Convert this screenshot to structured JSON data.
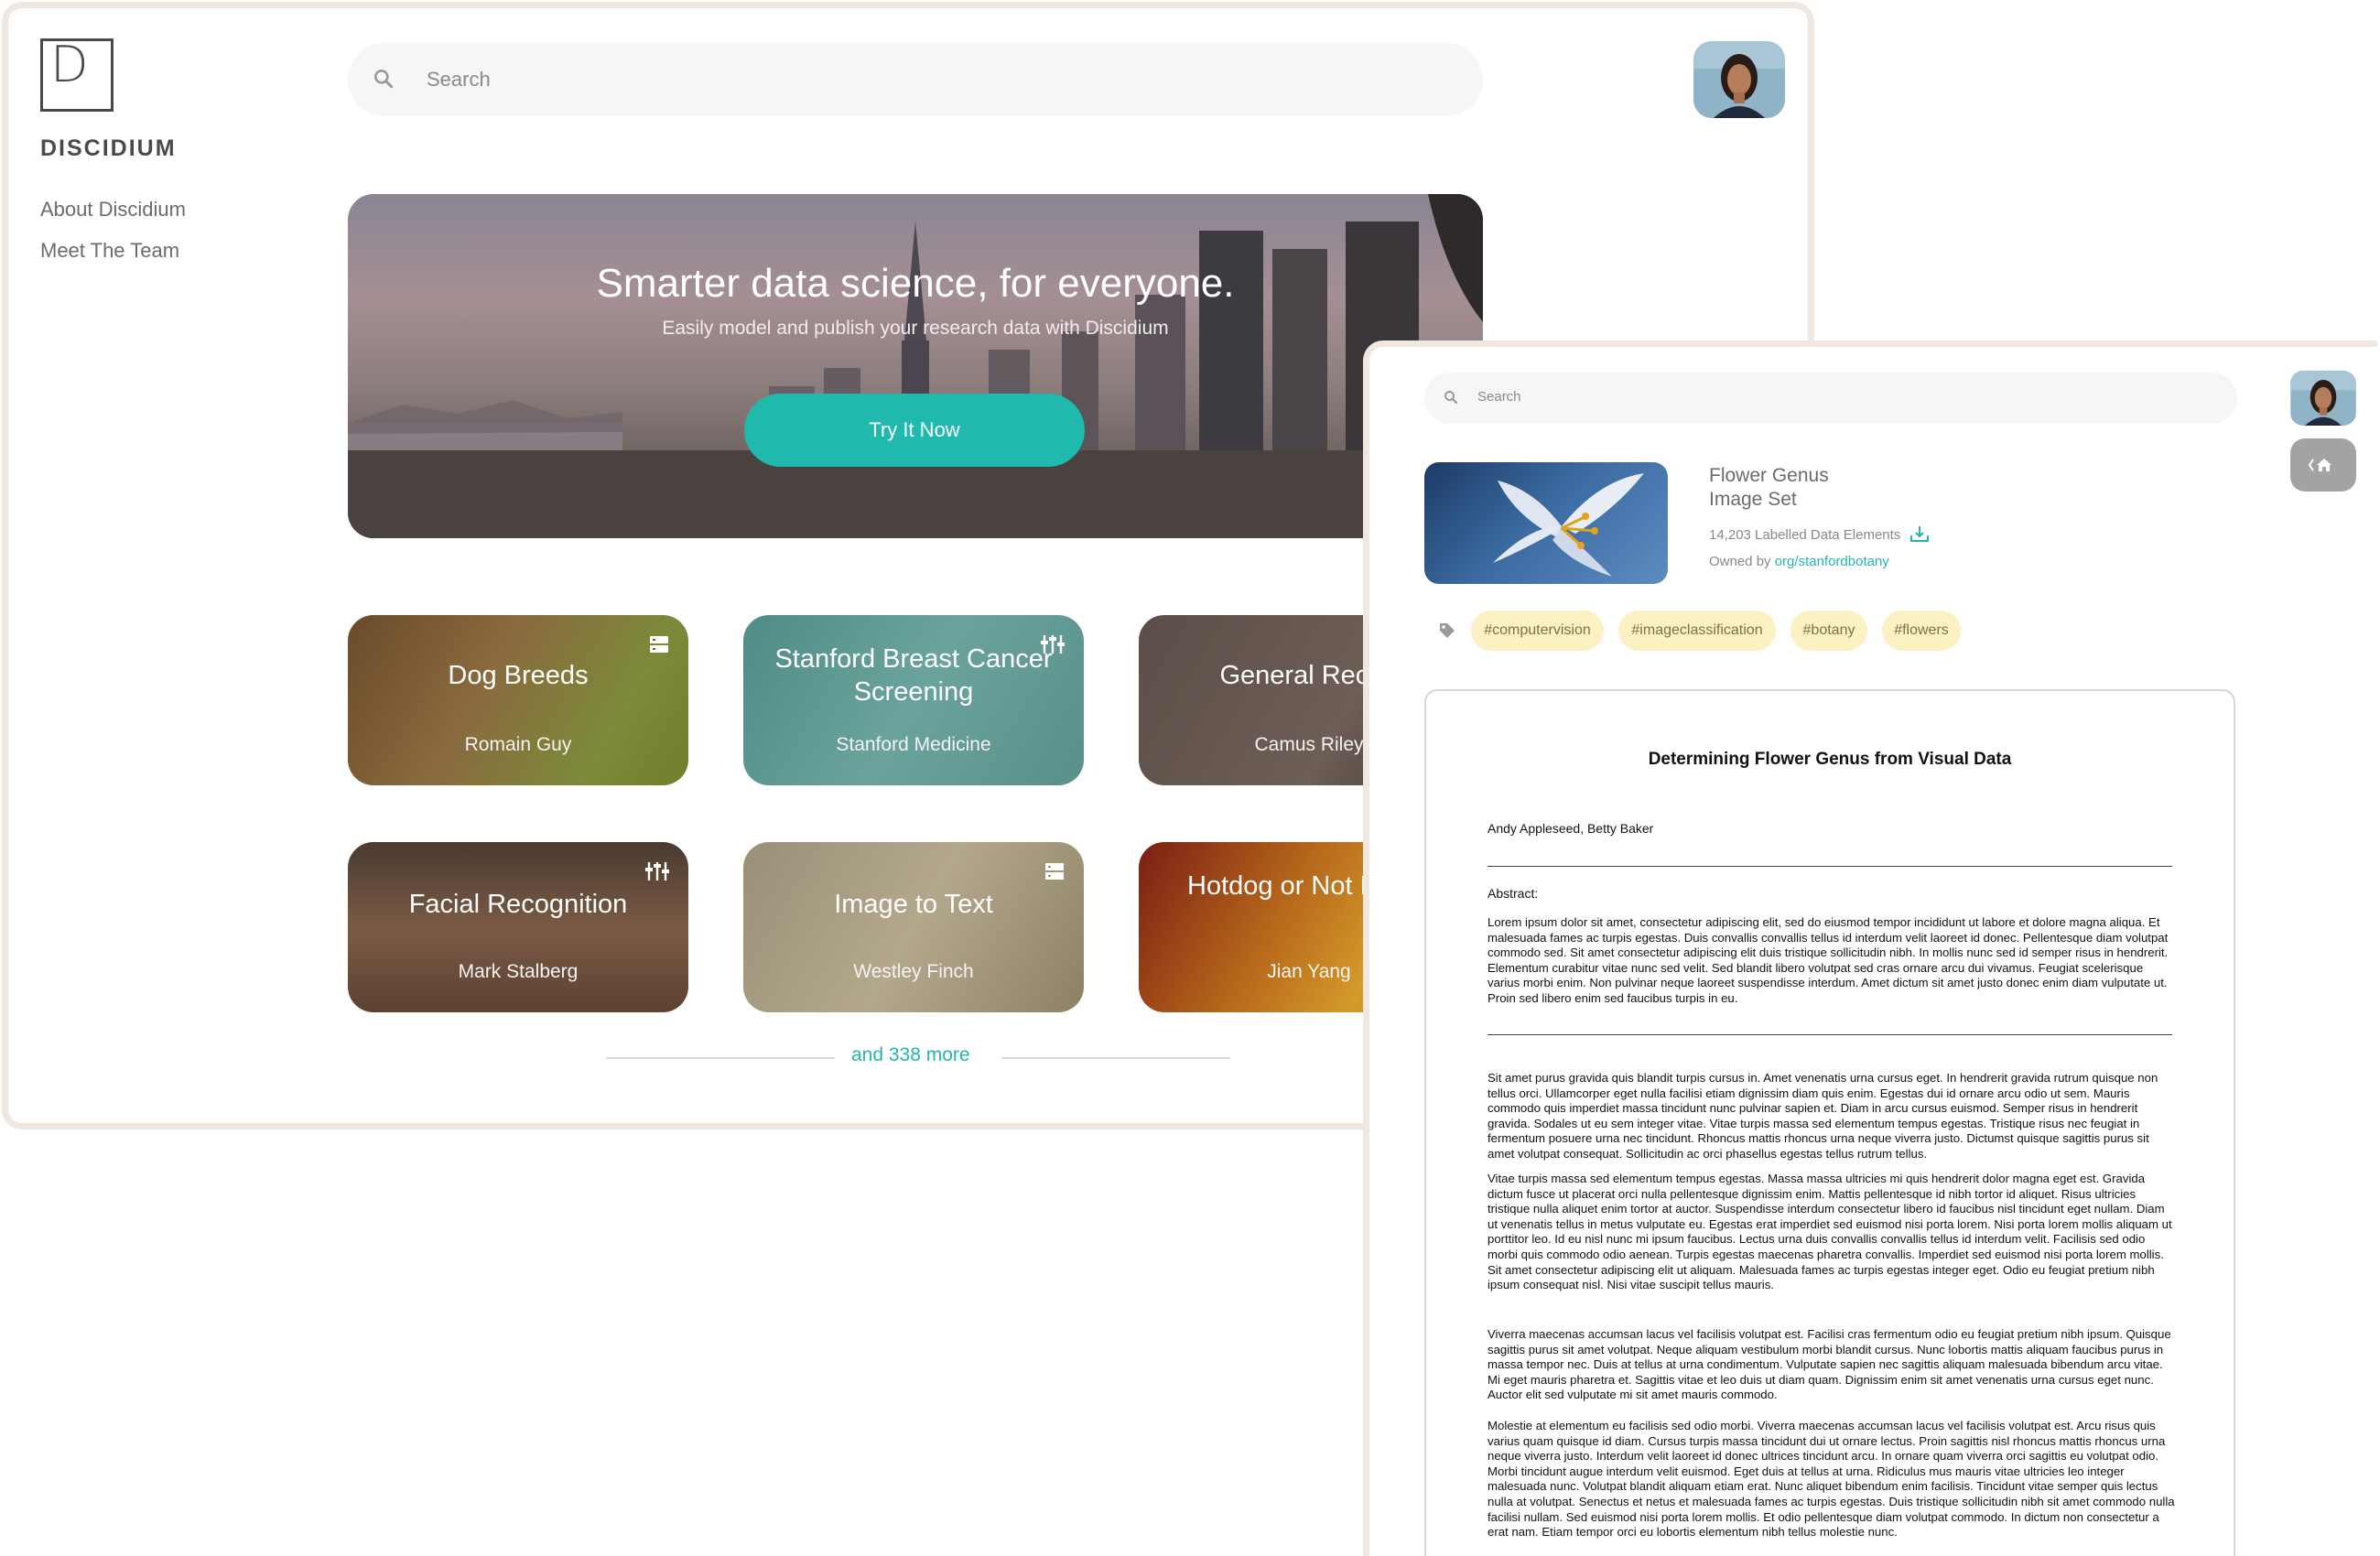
{
  "main_window": {
    "brand": {
      "logo_letter": "D",
      "name": "DISCIDIUM"
    },
    "sidebar": {
      "items": [
        {
          "label": "About Discidium"
        },
        {
          "label": "Meet The Team"
        }
      ]
    },
    "search": {
      "placeholder": "Search"
    },
    "hero": {
      "title": "Smarter data science, for everyone.",
      "subtitle": "Easily model and publish your research data with Discidium",
      "cta_label": "Try It Now"
    },
    "projects": [
      {
        "title": "Dog Breeds",
        "author": "Romain Guy",
        "icon": "server-icon"
      },
      {
        "title": "Stanford Breast Cancer Screening",
        "author": "Stanford Medicine",
        "icon": "equalizer-icon"
      },
      {
        "title": "General Recog",
        "author": "Camus Riley",
        "icon": ""
      },
      {
        "title": "Facial Recognition",
        "author": "Mark Stalberg",
        "icon": "equalizer-icon"
      },
      {
        "title": "Image to Text",
        "author": "Westley Finch",
        "icon": "server-icon"
      },
      {
        "title": "Hotdog or Not Hotdo",
        "author": "Jian Yang",
        "icon": ""
      }
    ],
    "more_label": "and 338 more",
    "colors": {
      "accent": "#1fb9ae",
      "frame": "#efe7e0"
    }
  },
  "detail_window": {
    "search": {
      "placeholder": "Search"
    },
    "dataset": {
      "title_line1": "Flower Genus",
      "title_line2": "Image Set",
      "count": "14,203 Labelled Data Elements",
      "owner_prefix": "Owned by",
      "owner_link": "org/stanfordbotany"
    },
    "tags": [
      "#computervision",
      "#imageclassification",
      "#botany",
      "#flowers"
    ],
    "paper": {
      "title": "Determining Flower Genus from Visual Data",
      "authors": "Andy Appleseed, Betty Baker",
      "abstract_label": "Abstract:",
      "abstract": "Lorem ipsum dolor sit amet, consectetur adipiscing elit, sed do eiusmod tempor incididunt ut labore et dolore magna aliqua. Et malesuada fames ac turpis egestas. Duis convallis convallis tellus id interdum velit laoreet id donec. Pellentesque diam volutpat commodo sed. Sit amet consectetur adipiscing elit duis tristique sollicitudin nibh. In mollis nunc sed id semper risus in hendrerit. Elementum curabitur vitae nunc sed velit. Sed blandit libero volutpat sed cras ornare arcu dui vivamus. Feugiat scelerisque varius morbi enim. Non pulvinar neque laoreet suspendisse interdum. Amet dictum sit amet justo donec enim diam vulputate ut. Proin sed libero enim sed faucibus turpis in eu.",
      "paragraphs": [
        "Sit amet purus gravida quis blandit turpis cursus in. Amet venenatis urna cursus eget. In hendrerit gravida rutrum quisque non tellus orci. Ullamcorper eget nulla facilisi etiam dignissim diam quis enim. Egestas dui id ornare arcu odio ut sem. Mauris commodo quis imperdiet massa tincidunt nunc pulvinar sapien et. Diam in arcu cursus euismod. Semper risus in hendrerit gravida. Sodales ut eu sem integer vitae. Vitae turpis massa sed elementum tempus egestas. Tristique risus nec feugiat in fermentum posuere urna nec tincidunt. Rhoncus mattis rhoncus urna neque viverra justo. Dictumst quisque sagittis purus sit amet volutpat consequat. Sollicitudin ac orci phasellus egestas tellus rutrum tellus.",
        "Vitae turpis massa sed elementum tempus egestas. Massa massa ultricies mi quis hendrerit dolor magna eget est. Gravida dictum fusce ut placerat orci nulla pellentesque dignissim enim. Mattis pellentesque id nibh tortor id aliquet. Risus ultricies tristique nulla aliquet enim tortor at auctor. Suspendisse interdum consectetur libero id faucibus nisl tincidunt eget nullam. Diam ut venenatis tellus in metus vulputate eu. Egestas erat imperdiet sed euismod nisi porta lorem. Nisi porta lorem mollis aliquam ut porttitor leo. Id eu nisl nunc mi ipsum faucibus. Lectus urna duis convallis convallis tellus id interdum velit. Facilisis sed odio morbi quis commodo odio aenean. Turpis egestas maecenas pharetra convallis. Imperdiet sed euismod nisi porta lorem mollis. Sit amet consectetur adipiscing elit ut aliquam. Malesuada fames ac turpis egestas integer eget. Odio eu feugiat pretium nibh ipsum consequat nisl. Nisi vitae suscipit tellus mauris.",
        "Viverra maecenas accumsan lacus vel facilisis volutpat est. Facilisi cras fermentum odio eu feugiat pretium nibh ipsum. Quisque sagittis purus sit amet volutpat. Neque aliquam vestibulum morbi blandit cursus. Nunc lobortis mattis aliquam faucibus purus in massa tempor nec. Duis at tellus at urna condimentum. Vulputate sapien nec sagittis aliquam malesuada bibendum arcu vitae. Mi eget mauris pharetra et. Sagittis vitae et leo duis ut diam quam. Dignissim enim sit amet venenatis urna cursus eget nunc. Auctor elit sed vulputate mi sit amet mauris commodo.",
        "Molestie at elementum eu facilisis sed odio morbi. Viverra maecenas accumsan lacus vel facilisis volutpat est. Arcu risus quis varius quam quisque id diam. Cursus turpis massa tincidunt dui ut ornare lectus. Proin sagittis nisl rhoncus mattis rhoncus urna neque viverra justo. Interdum velit laoreet id donec ultrices tincidunt arcu. In ornare quam viverra orci sagittis eu volutpat odio. Morbi tincidunt augue interdum velit euismod. Eget duis at tellus at urna. Ridiculus mus mauris vitae ultricies leo integer malesuada nunc. Volutpat blandit aliquam etiam erat. Nunc aliquet bibendum enim facilisis. Tincidunt vitae semper quis lectus nulla at volutpat. Senectus et netus et malesuada fames ac turpis egestas. Duis tristique sollicitudin nibh sit amet commodo nulla facilisi nullam. Sed euismod nisi porta lorem mollis. Et odio pellentesque diam volutpat commodo. In dictum non consectetur a erat nam. Etiam tempor orci eu lobortis elementum nibh tellus molestie nunc."
      ]
    }
  }
}
